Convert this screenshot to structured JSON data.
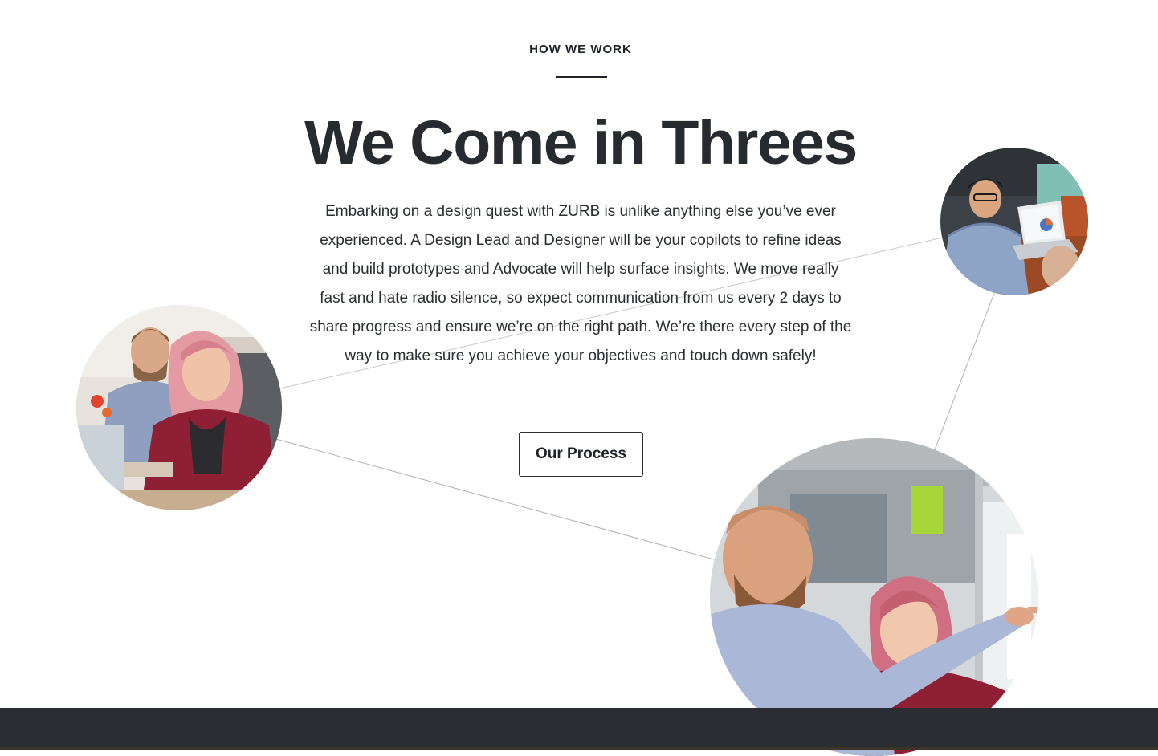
{
  "section": {
    "eyebrow": "HOW WE WORK",
    "headline": "We Come in Threes",
    "body": "Embarking on a design quest with ZURB is unlike anything else you’ve ever experienced. A Design Lead and Designer will be your copilots to refine ideas and build prototypes and Advocate will help surface insights. We move really fast and hate radio silence, so expect communication from us every 2 days to share progress and ensure we’re on the right path. We’re there every step of the way to make sure you achieve your objectives and touch down safely!",
    "cta_label": "Our Process"
  },
  "photos": [
    {
      "name": "team-photo-left",
      "subject": "two colleagues at a desk, woman with pink hair smiling"
    },
    {
      "name": "team-photo-top-right",
      "subject": "man with glasses working on a laptop"
    },
    {
      "name": "team-photo-bottom-right",
      "subject": "man and woman reviewing notes on a whiteboard"
    }
  ],
  "colors": {
    "text": "#1f2227",
    "background": "#ffffff",
    "footer_band": "#2a2d31",
    "connector_line": "#b8b8b8"
  }
}
